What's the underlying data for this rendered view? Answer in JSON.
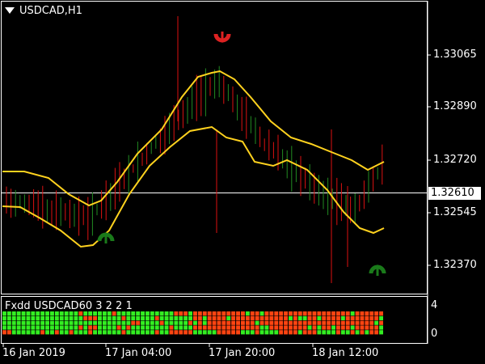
{
  "window": {
    "title": "USDCAD,H1"
  },
  "price_axis": {
    "labels": [
      "1.33065",
      "1.32890",
      "1.32720",
      "1.32545",
      "1.32370"
    ],
    "current_price": "1.32610"
  },
  "time_axis": {
    "labels": [
      "16 Jan 2019",
      "17 Jan 04:00",
      "17 Jan 20:00",
      "18 Jan 12:00"
    ]
  },
  "indicator": {
    "name": "Fxdd USDCAD60 3 2 2 1",
    "axis_labels": [
      "4",
      "0"
    ],
    "colors": {
      "up": "#33ee22",
      "down": "#ff4411"
    }
  },
  "colors": {
    "background": "#000000",
    "bull_candle": "#228b22",
    "bear_candle": "#dd1111",
    "band": "#ffd21e",
    "sell_arrow": "#dd2222",
    "buy_arrow": "#1a7a1a"
  },
  "signals": {
    "sell": "sell-arrow",
    "buy": "buy-arrow"
  }
}
